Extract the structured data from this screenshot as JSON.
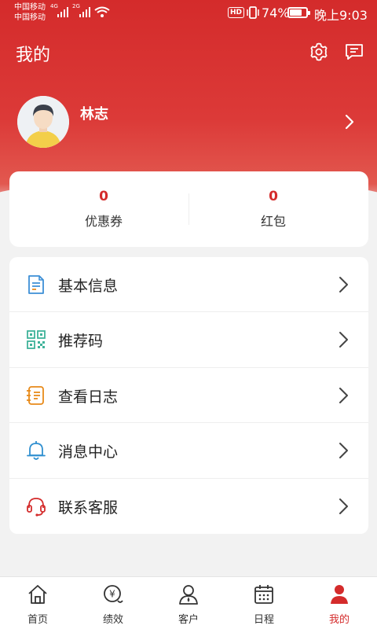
{
  "status_bar": {
    "carrier_1": "中国移动",
    "carrier_2": "中国移动",
    "net_1": "4G",
    "net_2": "2G",
    "hd": "HD",
    "battery_percent": "74%",
    "battery_level": 0.74,
    "time": "晚上9:03"
  },
  "header": {
    "title": "我的",
    "icons": [
      "gear-icon",
      "message-icon"
    ]
  },
  "profile": {
    "name": "林志"
  },
  "stats": [
    {
      "value": "0",
      "label": "优惠券"
    },
    {
      "value": "0",
      "label": "红包"
    }
  ],
  "menu": [
    {
      "label": "基本信息",
      "icon": "document-icon",
      "color": "#3d8fd6"
    },
    {
      "label": "推荐码",
      "icon": "qr-code-icon",
      "color": "#3fb39a"
    },
    {
      "label": "查看日志",
      "icon": "log-icon",
      "color": "#e88a1a"
    },
    {
      "label": "消息中心",
      "icon": "bell-icon",
      "color": "#2f8fd0"
    },
    {
      "label": "联系客服",
      "icon": "headset-icon",
      "color": "#d42b2b"
    }
  ],
  "bottom_nav": [
    {
      "label": "首页",
      "icon": "home-icon",
      "active": false
    },
    {
      "label": "绩效",
      "icon": "performance-icon",
      "active": false
    },
    {
      "label": "客户",
      "icon": "customer-icon",
      "active": false
    },
    {
      "label": "日程",
      "icon": "calendar-icon",
      "active": false
    },
    {
      "label": "我的",
      "icon": "profile-icon",
      "active": true
    }
  ],
  "colors": {
    "brand_red": "#d42b2b",
    "background": "#f2f2f2"
  }
}
